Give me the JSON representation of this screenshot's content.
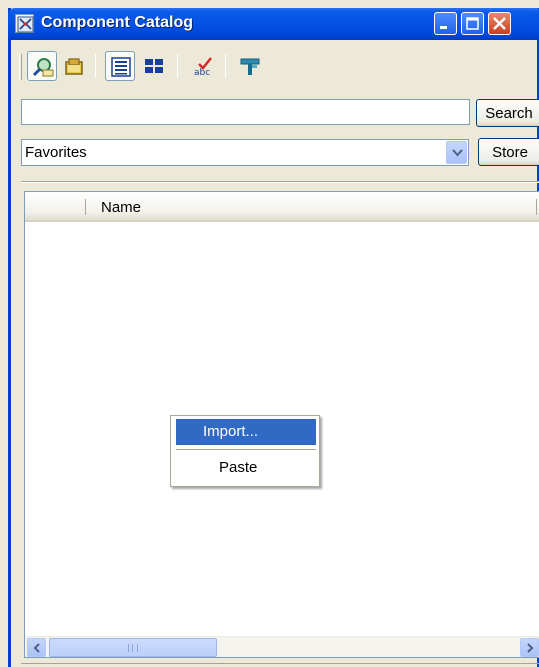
{
  "window": {
    "title": "Component Catalog",
    "icons": [
      "catalog-app-icon",
      "minimize-icon",
      "maximize-icon",
      "close-icon"
    ]
  },
  "toolbar": {
    "tools": [
      {
        "name": "find-tool",
        "icon": "magnifier-icon",
        "pressed": true
      },
      {
        "name": "open-catalog-tool",
        "icon": "folder-icon",
        "pressed": false
      },
      {
        "name": "list-view-tool",
        "icon": "list-view-icon",
        "pressed": true
      },
      {
        "name": "tile-view-tool",
        "icon": "tile-view-icon",
        "pressed": false
      },
      {
        "name": "spelling-tool",
        "icon": "spelling-check-icon",
        "pressed": false
      },
      {
        "name": "properties-tool",
        "icon": "hammer-icon",
        "pressed": false
      }
    ]
  },
  "search": {
    "value": "",
    "button_label": "Search"
  },
  "catalog_select": {
    "selected": "Favorites",
    "store_label": "Store"
  },
  "list": {
    "columns": [
      "Name"
    ]
  },
  "context_menu": {
    "items": [
      "Import...",
      "Paste"
    ],
    "highlighted_index": 0
  },
  "colors": {
    "titlebar": "#0551e5",
    "menu_highlight": "#316ac5",
    "window_bg": "#ece9d8"
  }
}
